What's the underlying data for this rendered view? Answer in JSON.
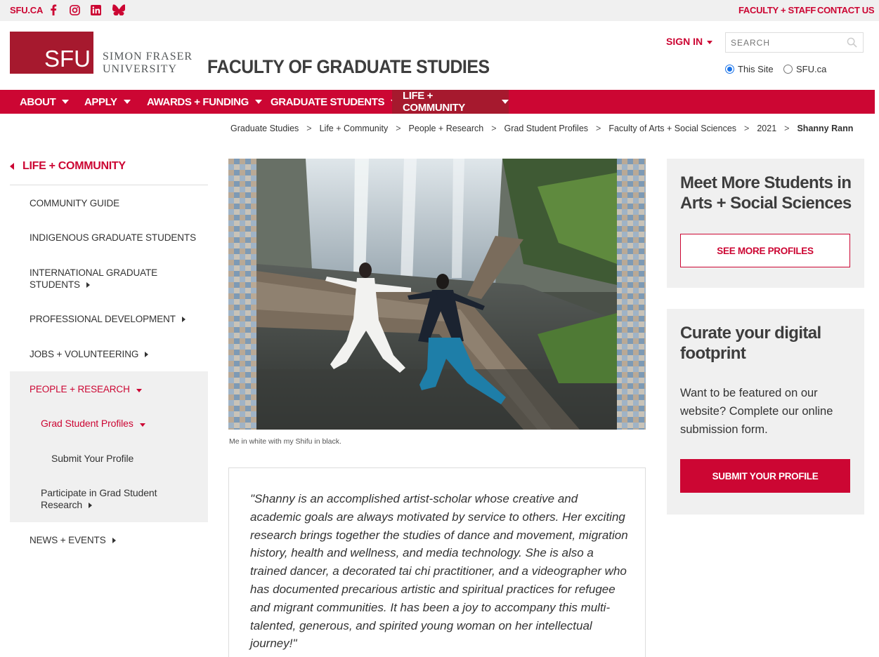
{
  "topbar": {
    "sfu_link": "SFU.CA",
    "faculty_staff": "FACULTY + STAFF",
    "contact_us": "CONTACT US"
  },
  "header": {
    "logo_text": "SFU",
    "university_line1": "SIMON FRASER",
    "university_line2": "UNIVERSITY",
    "faculty_title": "FACULTY OF GRADUATE STUDIES",
    "sign_in": "SIGN IN",
    "search_placeholder": "SEARCH",
    "radio_this_site": "This Site",
    "radio_sfu": "SFU.ca"
  },
  "nav": {
    "items": [
      "ABOUT",
      "APPLY",
      "AWARDS + FUNDING",
      "GRADUATE STUDENTS",
      "LIFE + COMMUNITY"
    ]
  },
  "breadcrumb": {
    "items": [
      "Graduate Studies",
      "Life + Community",
      "People + Research",
      "Grad Student Profiles",
      "Faculty of Arts + Social Sciences",
      "2021"
    ],
    "current": "Shanny Rann"
  },
  "sidebar": {
    "heading": "LIFE + COMMUNITY",
    "items": {
      "community_guide": "COMMUNITY GUIDE",
      "indigenous": "INDIGENOUS GRADUATE STUDENTS",
      "international_1": "INTERNATIONAL GRADUATE",
      "international_2": "STUDENTS",
      "professional": "PROFESSIONAL DEVELOPMENT",
      "jobs": "JOBS + VOLUNTEERING",
      "people": "PEOPLE + RESEARCH",
      "grad_profiles": "Grad Student Profiles",
      "submit_profile": "Submit Your Profile",
      "participate_1": "Participate in Grad Student",
      "participate_2": "Research",
      "news": "NEWS + EVENTS"
    }
  },
  "main": {
    "caption": "Me in white with my Shifu in black.",
    "quote": "\"Shanny is an accomplished artist-scholar whose creative and academic goals are always motivated by service to others.  Her exciting research brings together the studies of dance and movement, migration history, health and wellness, and media technology.  She is also a trained dancer, a decorated tai chi practitioner, and a videographer who has documented precarious artistic and spiritual practices for refugee and migrant communities. It has been a joy to accompany this multi-talented, generous, and spirited young woman on her intellectual journey!\""
  },
  "right": {
    "card1_title": "Meet More Students in Arts + Social Sciences",
    "card1_button": "SEE MORE PROFILES",
    "card2_title": "Curate your digital footprint",
    "card2_body": "Want to be featured on our website? Complete our online submission form.",
    "card2_button": "SUBMIT YOUR PROFILE"
  },
  "colors": {
    "brand_red": "#cc0633",
    "logo_red": "#a6192e",
    "panel_grey": "#f0f0f0"
  }
}
